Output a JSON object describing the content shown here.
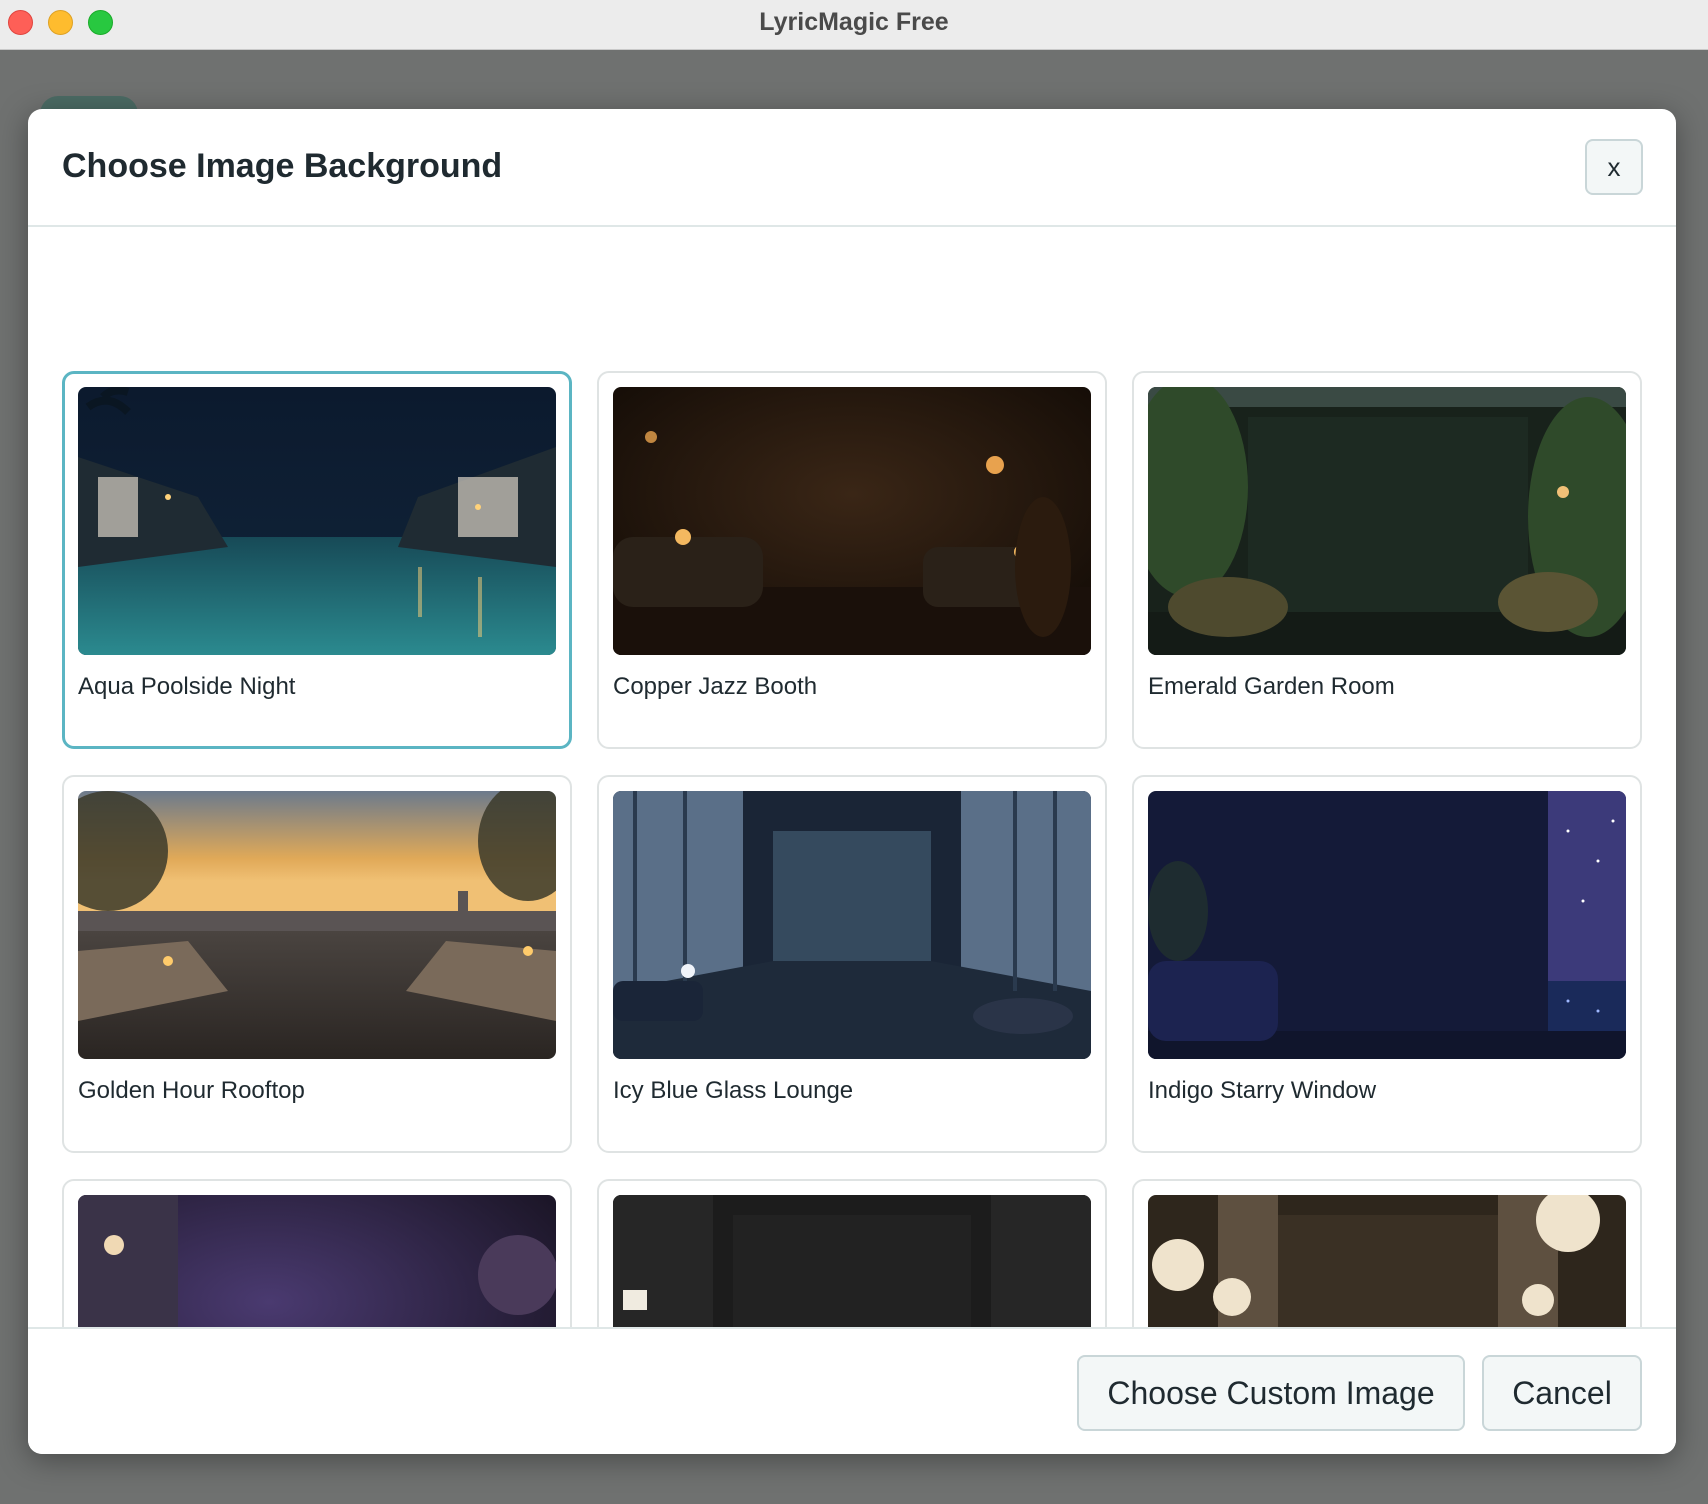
{
  "window": {
    "title": "LyricMagic Free"
  },
  "dialog": {
    "title": "Choose Image Background",
    "close_label": "x"
  },
  "backgrounds": [
    {
      "label": "Aqua Poolside Night",
      "selected": true
    },
    {
      "label": "Copper Jazz Booth",
      "selected": false
    },
    {
      "label": "Emerald Garden Room",
      "selected": false
    },
    {
      "label": "Golden Hour Rooftop",
      "selected": false
    },
    {
      "label": "Icy Blue Glass Lounge",
      "selected": false
    },
    {
      "label": "Indigo Starry Window",
      "selected": false
    },
    {
      "label": "",
      "selected": false
    },
    {
      "label": "",
      "selected": false
    },
    {
      "label": "",
      "selected": false
    }
  ],
  "footer": {
    "custom_label": "Choose Custom Image",
    "cancel_label": "Cancel"
  },
  "colors": {
    "selected_border": "#5bb5c3",
    "overlay": "#6f7170"
  }
}
